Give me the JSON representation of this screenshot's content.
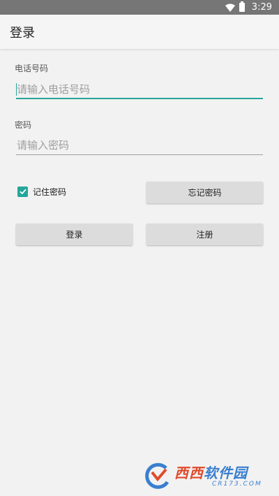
{
  "status_bar": {
    "time": "3:29"
  },
  "app_bar": {
    "title": "登录"
  },
  "form": {
    "phone": {
      "label": "电话号码",
      "placeholder": "请输入电话号码",
      "value": ""
    },
    "password": {
      "label": "密码",
      "placeholder": "请输入密码",
      "value": ""
    },
    "remember": {
      "label": "记住密码",
      "checked": true
    },
    "forgot_label": "忘记密码",
    "login_label": "登录",
    "register_label": "注册"
  },
  "watermark": {
    "brand_red": "西西",
    "brand_blue": "软件园",
    "domain": "CR173.COM"
  },
  "colors": {
    "accent": "#26a69a",
    "status_bar": "#767676",
    "button": "#dcdcdc"
  }
}
